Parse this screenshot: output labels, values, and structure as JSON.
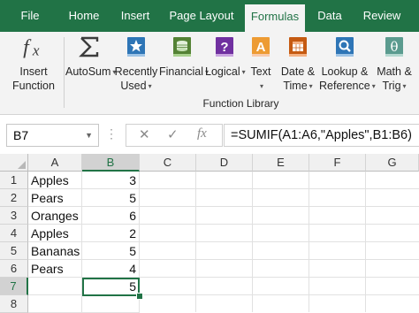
{
  "tabs": [
    {
      "label": "File",
      "active": false
    },
    {
      "label": "Home",
      "active": false
    },
    {
      "label": "Insert",
      "active": false
    },
    {
      "label": "Page Layout",
      "active": false
    },
    {
      "label": "Formulas",
      "active": true
    },
    {
      "label": "Data",
      "active": false
    },
    {
      "label": "Review",
      "active": false
    }
  ],
  "ribbon": {
    "insert_function": {
      "label_line1": "Insert",
      "label_line2": "Function",
      "icon": "fx-icon"
    },
    "autosum": {
      "label": "AutoSum",
      "icon": "sigma-icon"
    },
    "recently_used": {
      "label_line1": "Recently",
      "label_line2": "Used",
      "icon": "star-book-icon"
    },
    "financial": {
      "label": "Financial",
      "icon": "coins-book-icon"
    },
    "logical": {
      "label": "Logical",
      "icon": "question-book-icon"
    },
    "text": {
      "label": "Text",
      "icon": "letter-a-book-icon"
    },
    "date_time": {
      "label_line1": "Date &",
      "label_line2": "Time",
      "icon": "calendar-book-icon"
    },
    "lookup_reference": {
      "label_line1": "Lookup &",
      "label_line2": "Reference",
      "icon": "magnifier-book-icon"
    },
    "math_trig": {
      "label_line1": "Math &",
      "label_line2": "Trig",
      "icon": "theta-book-icon"
    },
    "group_label": "Function Library"
  },
  "formula_bar": {
    "name_box": "B7",
    "fx_label": "fx",
    "formula": "=SUMIF(A1:A6,\"Apples\",B1:B6)"
  },
  "sheet": {
    "columns": [
      "A",
      "B",
      "C",
      "D",
      "E",
      "F",
      "G"
    ],
    "selected_column": "B",
    "selected_row": "7",
    "rows": [
      {
        "num": "1",
        "a": "Apples",
        "b": "3"
      },
      {
        "num": "2",
        "a": "Pears",
        "b": "5"
      },
      {
        "num": "3",
        "a": "Oranges",
        "b": "6"
      },
      {
        "num": "4",
        "a": "Apples",
        "b": "2"
      },
      {
        "num": "5",
        "a": "Bananas",
        "b": "5"
      },
      {
        "num": "6",
        "a": "Pears",
        "b": "4"
      },
      {
        "num": "7",
        "a": "",
        "b": "5"
      },
      {
        "num": "8",
        "a": "",
        "b": ""
      }
    ]
  },
  "colors": {
    "accent": "#217346",
    "tab_text_active": "#217346",
    "ribbon_bg": "#f3f3f3"
  }
}
